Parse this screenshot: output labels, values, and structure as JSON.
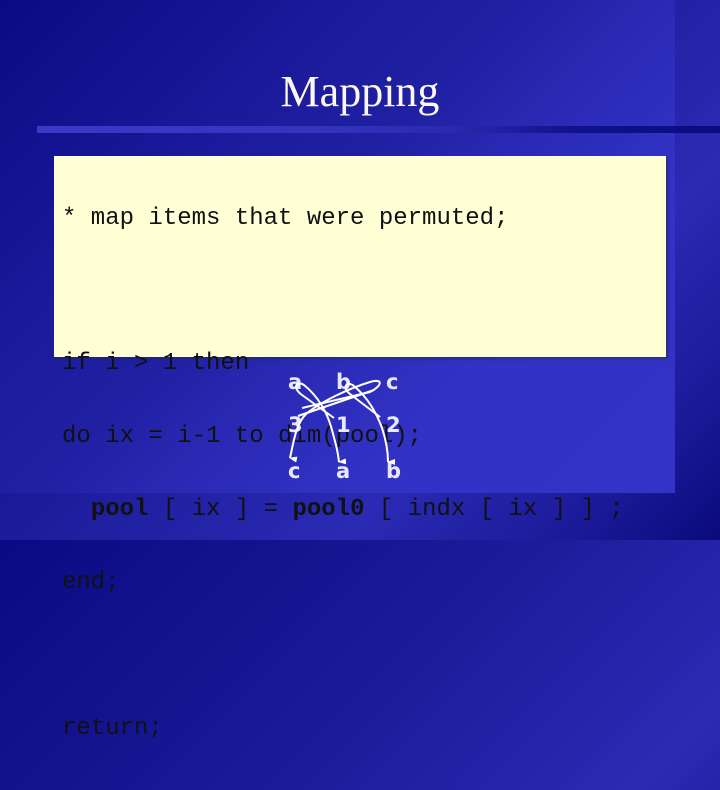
{
  "slide": {
    "title": "Mapping"
  },
  "code": {
    "lines": [
      {
        "text": "* map items that were permuted;"
      },
      {
        "text": ""
      },
      {
        "text": "if i > 1 then"
      },
      {
        "text": "do ix = i-1 to dim(pool);"
      },
      {
        "parts": [
          {
            "text": "  ",
            "bold": false
          },
          {
            "text": "pool",
            "bold": true
          },
          {
            "text": " [ ix ] = ",
            "bold": false
          },
          {
            "text": "pool0",
            "bold": true
          },
          {
            "text": " [ indx [ ix ] ] ;",
            "bold": false
          }
        ]
      },
      {
        "text": "end;"
      },
      {
        "text": ""
      },
      {
        "text": "return;"
      }
    ]
  },
  "diagram": {
    "top_row": [
      "a",
      "b",
      "c"
    ],
    "index_row": [
      "3",
      "1",
      "2"
    ],
    "bottom_row": [
      "c",
      "a",
      "b"
    ],
    "colors": {
      "arrow": "#ffffff",
      "label": "#e8e8ff"
    }
  }
}
